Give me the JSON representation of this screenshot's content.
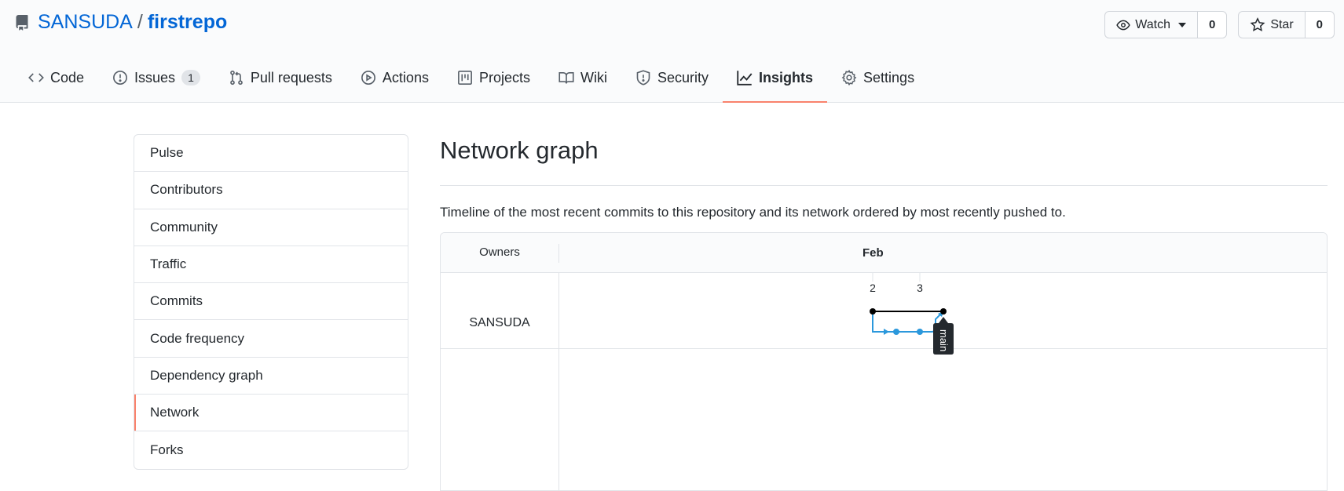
{
  "repo": {
    "owner": "SANSUDA",
    "separator": "/",
    "name": "firstrepo"
  },
  "actions": {
    "watch_label": "Watch",
    "watch_count": "0",
    "star_label": "Star",
    "star_count": "0"
  },
  "tabs": [
    {
      "label": "Code",
      "icon": "code-icon"
    },
    {
      "label": "Issues",
      "icon": "issue-icon",
      "counter": "1"
    },
    {
      "label": "Pull requests",
      "icon": "pull-request-icon"
    },
    {
      "label": "Actions",
      "icon": "play-icon"
    },
    {
      "label": "Projects",
      "icon": "project-icon"
    },
    {
      "label": "Wiki",
      "icon": "book-icon"
    },
    {
      "label": "Security",
      "icon": "shield-icon"
    },
    {
      "label": "Insights",
      "icon": "graph-icon",
      "selected": true
    },
    {
      "label": "Settings",
      "icon": "gear-icon"
    }
  ],
  "sidebar": {
    "items": [
      {
        "label": "Pulse"
      },
      {
        "label": "Contributors"
      },
      {
        "label": "Community"
      },
      {
        "label": "Traffic"
      },
      {
        "label": "Commits"
      },
      {
        "label": "Code frequency"
      },
      {
        "label": "Dependency graph"
      },
      {
        "label": "Network",
        "selected": true
      },
      {
        "label": "Forks"
      }
    ]
  },
  "main": {
    "title": "Network graph",
    "description": "Timeline of the most recent commits to this repository and its network ordered by most recently pushed to."
  },
  "network": {
    "owners_header": "Owners",
    "month": "Feb",
    "days": [
      "2",
      "3"
    ],
    "owner": "SANSUDA",
    "branch": "main",
    "colors": {
      "main_line": "#000000",
      "branch_line": "#2b98dc",
      "tag_bg": "#24292e",
      "accent": "#f9826c"
    }
  }
}
